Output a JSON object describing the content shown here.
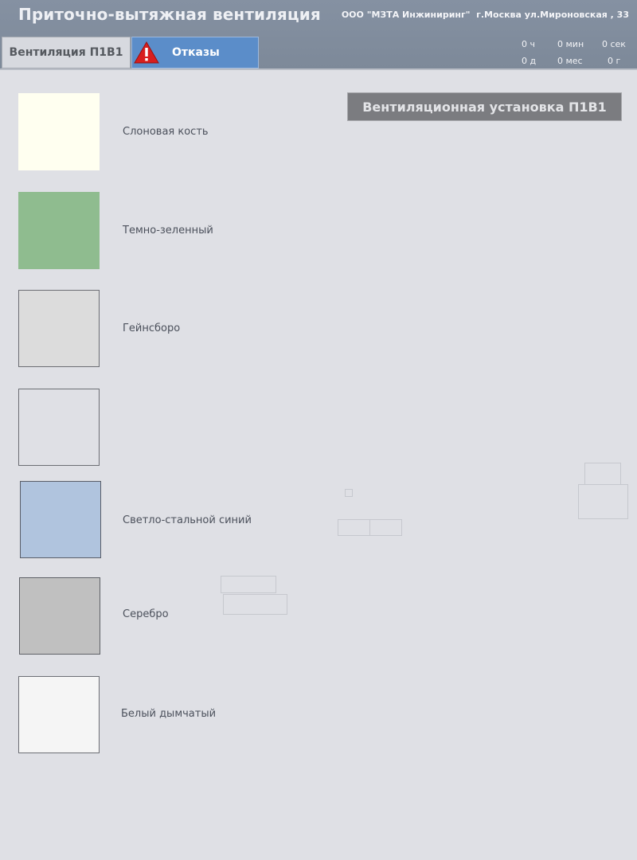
{
  "header": {
    "title": "Приточно-вытяжная вентиляция",
    "company": "ООО \"МЗТА Инжиниринг\"  г.Москва ул.Мироновская , 33"
  },
  "tabs": {
    "ventilation": "Вентиляция П1В1",
    "faults": "Отказы"
  },
  "uptime": {
    "hours": "0 ч",
    "minutes": "0 мин",
    "seconds": "0 сек",
    "days": "0 д",
    "months": "0 мес",
    "years": "0 г"
  },
  "unit_title": "Вентиляционная установка П1В1",
  "swatches": [
    {
      "label": "Слоновая кость",
      "color": "#fffff0"
    },
    {
      "label": "Темно-зеленный",
      "color": "#8fbc8f"
    },
    {
      "label": "Гейнсборо",
      "color": "#dcdcdc"
    },
    {
      "label": "",
      "color": "#dfe0e5"
    },
    {
      "label": "Светло-стальной синий",
      "color": "#b0c4de"
    },
    {
      "label": "Серебро",
      "color": "#c0c0c0"
    },
    {
      "label": "Белый дымчатый",
      "color": "#f5f5f5"
    }
  ],
  "colors": {
    "background": "#dfe0e5",
    "header": "#8290a0",
    "faults_tab": "#5b8dc9",
    "warning": "#d81e1e"
  }
}
